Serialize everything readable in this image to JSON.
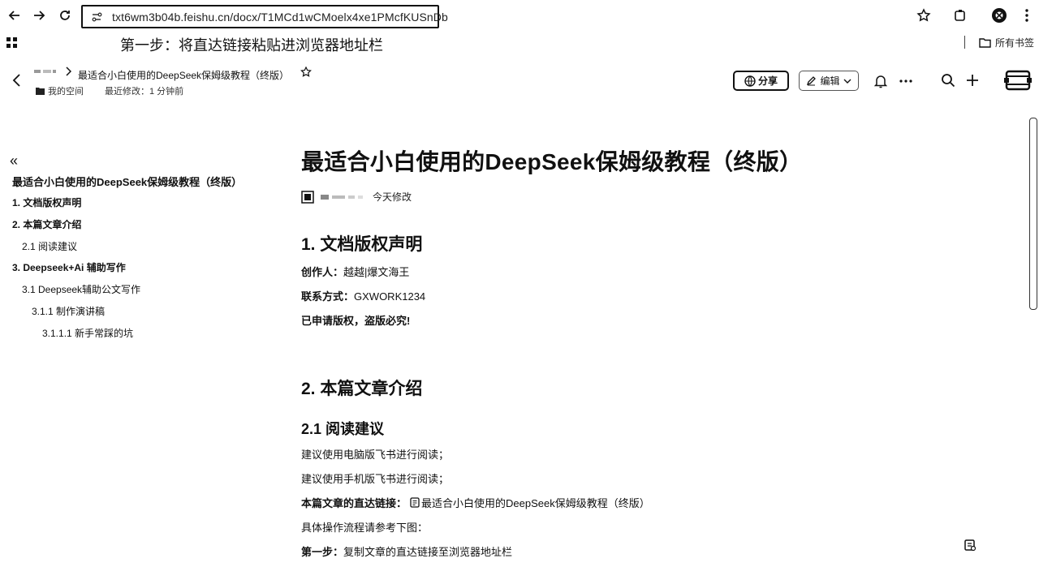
{
  "browser": {
    "url": "txt6wm3b04b.feishu.cn/docx/T1MCd1wCMoelx4xe1PMcfKUSnDb",
    "all_bookmarks_label": "所有书签"
  },
  "annotation": {
    "text": "第一步：将直达链接粘贴进浏览器地址栏"
  },
  "doc_header": {
    "breadcrumb_title": "最适合小白使用的DeepSeek保姆级教程（终版）",
    "space_label": "我的空间",
    "last_modified": "最近修改：1 分钟前",
    "share_label": "分享",
    "edit_label": "编辑"
  },
  "toc": {
    "title": "最适合小白使用的DeepSeek保姆级教程（终版）",
    "items": [
      {
        "label": "1. 文档版权声明",
        "level": 1
      },
      {
        "label": "2. 本篇文章介绍",
        "level": 1
      },
      {
        "label": "2.1 阅读建议",
        "level": 2
      },
      {
        "label": "3. Deepseek+Ai 辅助写作",
        "level": 1
      },
      {
        "label": "3.1 Deepseek辅助公文写作",
        "level": 2
      },
      {
        "label": "3.1.1 制作演讲稿",
        "level": 3
      },
      {
        "label": "3.1.1.1 新手常踩的坑",
        "level": 4
      }
    ]
  },
  "content": {
    "title": "最适合小白使用的DeepSeek保姆级教程（终版）",
    "modified_label": "今天修改",
    "section1": {
      "heading": "1. 文档版权声明",
      "creator_label": "创作人：",
      "creator_value": "越越|爆文海王",
      "contact_label": "联系方式：",
      "contact_value": "GXWORK1234",
      "copyright": "已申请版权，盗版必究!"
    },
    "section2": {
      "heading": "2. 本篇文章介绍",
      "sub_heading": "2.1 阅读建议",
      "line1": "建议使用电脑版飞书进行阅读；",
      "line2": "建议使用手机版飞书进行阅读；",
      "direct_link_label": "本篇文章的直达链接：",
      "direct_link_text": "最适合小白使用的DeepSeek保姆级教程（终版）",
      "flow_text": "具体操作流程请参考下图：",
      "step1_label": "第一步：",
      "step1_text": "复制文章的直达链接至浏览器地址栏"
    }
  }
}
